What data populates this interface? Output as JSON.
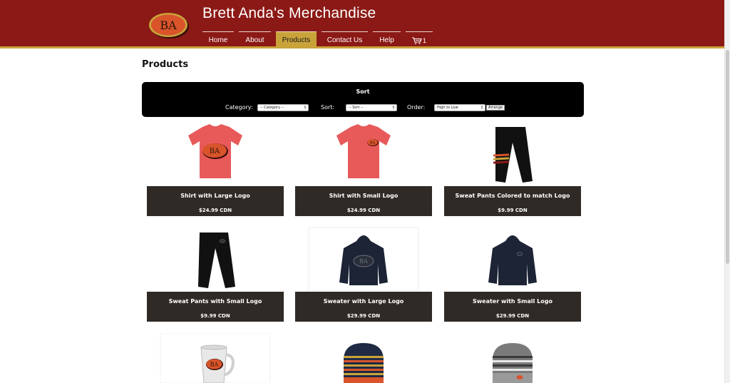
{
  "header": {
    "title": "Brett Anda's Merchandise",
    "logo_text": "BA",
    "nav": [
      {
        "label": "Home"
      },
      {
        "label": "About"
      },
      {
        "label": "Products"
      },
      {
        "label": "Contact Us"
      },
      {
        "label": "Help"
      },
      {
        "label": "1"
      }
    ],
    "active_nav": "Products"
  },
  "page": {
    "title": "Products"
  },
  "sort": {
    "heading": "Sort",
    "category_label": "Category:",
    "category_value": "-- Category --",
    "sort_label": "Sort:",
    "sort_value": "-- Sort --",
    "order_label": "Order:",
    "order_value": "High to Low",
    "arrange_label": "Arrange"
  },
  "products": [
    {
      "name": "Shirt with Large Logo",
      "price": "$24.99 CDN",
      "icon": "shirt-large-logo"
    },
    {
      "name": "Shirt with Small Logo",
      "price": "$24.99 CDN",
      "icon": "shirt-small-logo"
    },
    {
      "name": "Sweat Pants Colored to match Logo",
      "price": "$9.99 CDN",
      "icon": "pants-striped"
    },
    {
      "name": "Sweat Pants with Small Logo",
      "price": "$9.99 CDN",
      "icon": "pants-small-logo"
    },
    {
      "name": "Sweater with Large Logo",
      "price": "$29.99 CDN",
      "icon": "hoodie-large-logo"
    },
    {
      "name": "Sweater with Small Logo",
      "price": "$29.99 CDN",
      "icon": "hoodie-small-logo"
    },
    {
      "name": "",
      "price": "",
      "icon": "mug"
    },
    {
      "name": "",
      "price": "",
      "icon": "beanie-dark"
    },
    {
      "name": "",
      "price": "",
      "icon": "beanie-grey"
    }
  ],
  "colors": {
    "header_bg": "#8b1915",
    "accent_gold": "#c9a33a",
    "card_bg": "#2f2a25",
    "shirt": "#e85a5a",
    "logo_orange": "#d9542b"
  }
}
